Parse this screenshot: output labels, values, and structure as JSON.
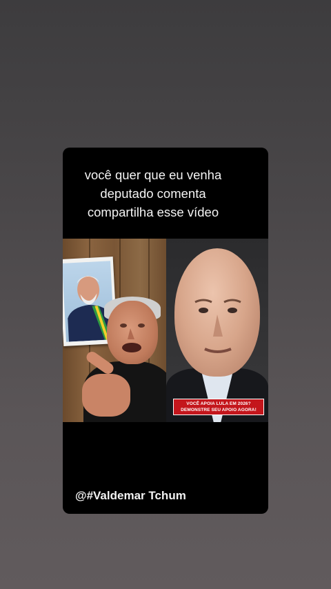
{
  "video": {
    "caption_lines": [
      "você quer que eu venha",
      "deputado comenta",
      "compartilha esse vídeo"
    ],
    "banner_lines": [
      "VOCÊ APOIA LULA EM 2026?",
      "DEMONSTRE SEU APOIO AGORA!"
    ],
    "watermark": "@#Valdemar Tchum"
  },
  "colors": {
    "background_top": "#3d3c3e",
    "background_bottom": "#615b5d",
    "card": "#000000",
    "banner": "#c4161c",
    "caption_text": "#f4f4f4"
  }
}
